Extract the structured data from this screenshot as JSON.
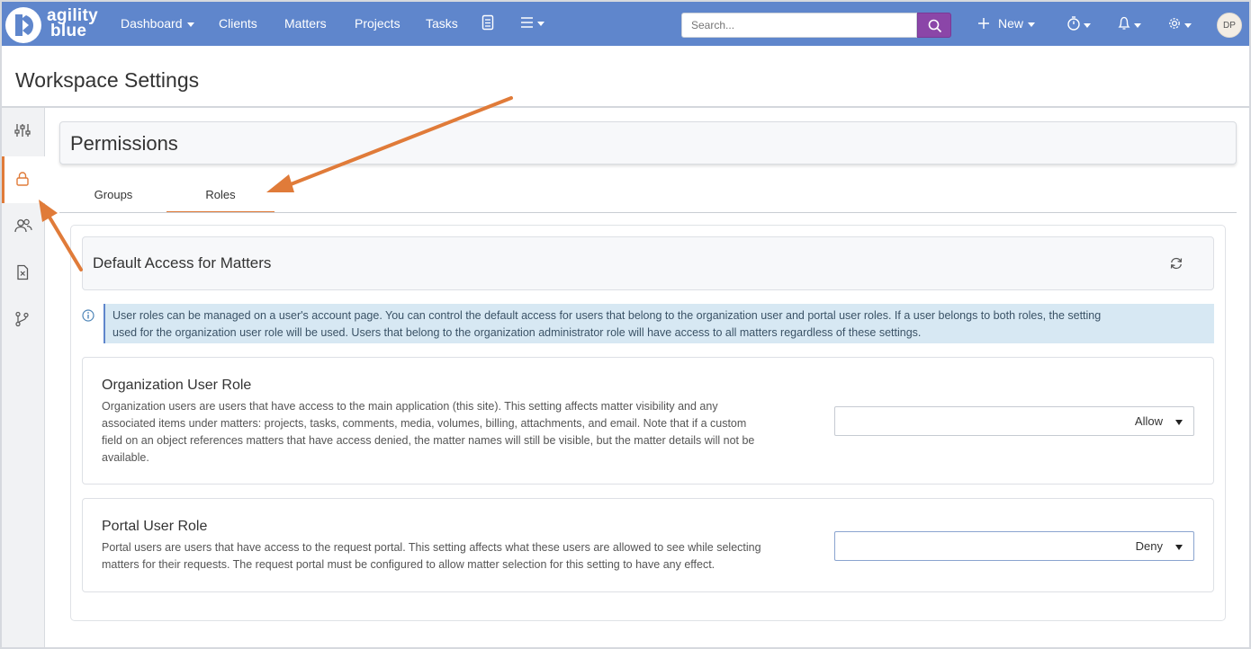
{
  "app": {
    "logo_line1": "agility",
    "logo_line2": "blue",
    "brand_color": "#5f86cc",
    "accent_color": "#e07b39",
    "search_button_color": "#8b46a8"
  },
  "nav": {
    "dashboard": "Dashboard",
    "clients": "Clients",
    "matters": "Matters",
    "projects": "Projects",
    "tasks": "Tasks",
    "search_placeholder": "Search...",
    "new_label": "New",
    "avatar_initials": "DP"
  },
  "page": {
    "title": "Workspace Settings"
  },
  "sidebar": {
    "items": [
      {
        "icon": "sliders-icon"
      },
      {
        "icon": "lock-icon",
        "active": true
      },
      {
        "icon": "users-icon"
      },
      {
        "icon": "file-x-icon"
      },
      {
        "icon": "branch-icon"
      }
    ]
  },
  "permissions": {
    "title": "Permissions",
    "tabs": [
      {
        "label": "Groups",
        "active": false
      },
      {
        "label": "Roles",
        "active": true
      }
    ]
  },
  "section": {
    "title": "Default Access for Matters",
    "info_line1": "User roles can be managed on a user's account page. You can control the default access for users that belong to the organization user and portal user roles. If a user belongs to both roles, the setting",
    "info_line2": "used for the organization user role will be used. Users that belong to the organization administrator role will have access to all matters regardless of these settings.",
    "roles": [
      {
        "title": "Organization User Role",
        "desc_lines": [
          "Organization users are users that have access to the main application (this site). This setting affects matter visibility and any",
          "associated items under matters: projects, tasks, comments, media, volumes, billing, attachments, and email. Note that if a custom",
          "field on an object references matters that have access denied, the matter names will still be visible, but the matter details will not be",
          "available."
        ],
        "value": "Allow"
      },
      {
        "title": "Portal User Role",
        "desc_lines": [
          "Portal users are users that have access to the request portal. This setting affects what these users are allowed to see while selecting",
          "matters for their requests. The request portal must be configured to allow matter selection for this setting to have any effect."
        ],
        "value": "Deny"
      }
    ]
  }
}
